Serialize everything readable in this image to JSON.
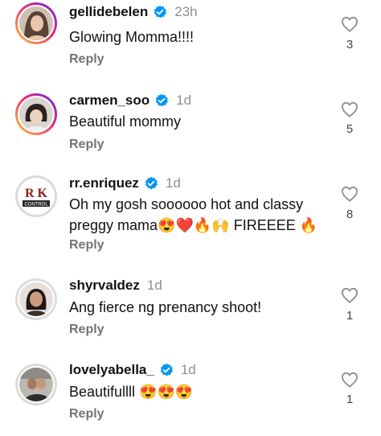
{
  "comments": [
    {
      "username": "gellidebelen",
      "verified": true,
      "time": "23h",
      "text": "Glowing Momma!!!!",
      "reply_label": "Reply",
      "likes": "3"
    },
    {
      "username": "carmen_soo",
      "verified": true,
      "time": "1d",
      "text": "Beautiful mommy",
      "reply_label": "Reply",
      "likes": "5"
    },
    {
      "username": "rr.enriquez",
      "verified": true,
      "time": "1d",
      "text_line1": "Oh my gosh soooooo hot and classy",
      "text_line2": "preggy mama",
      "text_line2_end": " FIREEEE ",
      "emoji_seq": [
        "😍",
        "❤️",
        "🔥",
        "🙌"
      ],
      "emoji_end": "🔥",
      "avatar_logo_text": "R K",
      "avatar_logo_sub": "CONTROL",
      "reply_label": "Reply",
      "likes": "8"
    },
    {
      "username": "shyrvaldez",
      "verified": false,
      "time": "1d",
      "text": "Ang fierce ng prenancy shoot!",
      "reply_label": "Reply",
      "likes": "1"
    },
    {
      "username": "lovelyabella_",
      "verified": true,
      "time": "1d",
      "text": "Beautifullll ",
      "emoji_seq": [
        "😍",
        "😍",
        "😍"
      ],
      "reply_label": "Reply",
      "likes": "1"
    }
  ],
  "colors": {
    "verified_badge": "#0095f6",
    "secondary_text": "#8e8e8e",
    "reply_text": "#737373",
    "story_ring_start": "#f9ce34",
    "story_ring_mid": "#ee2a7b",
    "story_ring_end": "#6228d7"
  },
  "icons": {
    "like": "heart-outline-icon",
    "verified": "verified-badge-icon"
  }
}
